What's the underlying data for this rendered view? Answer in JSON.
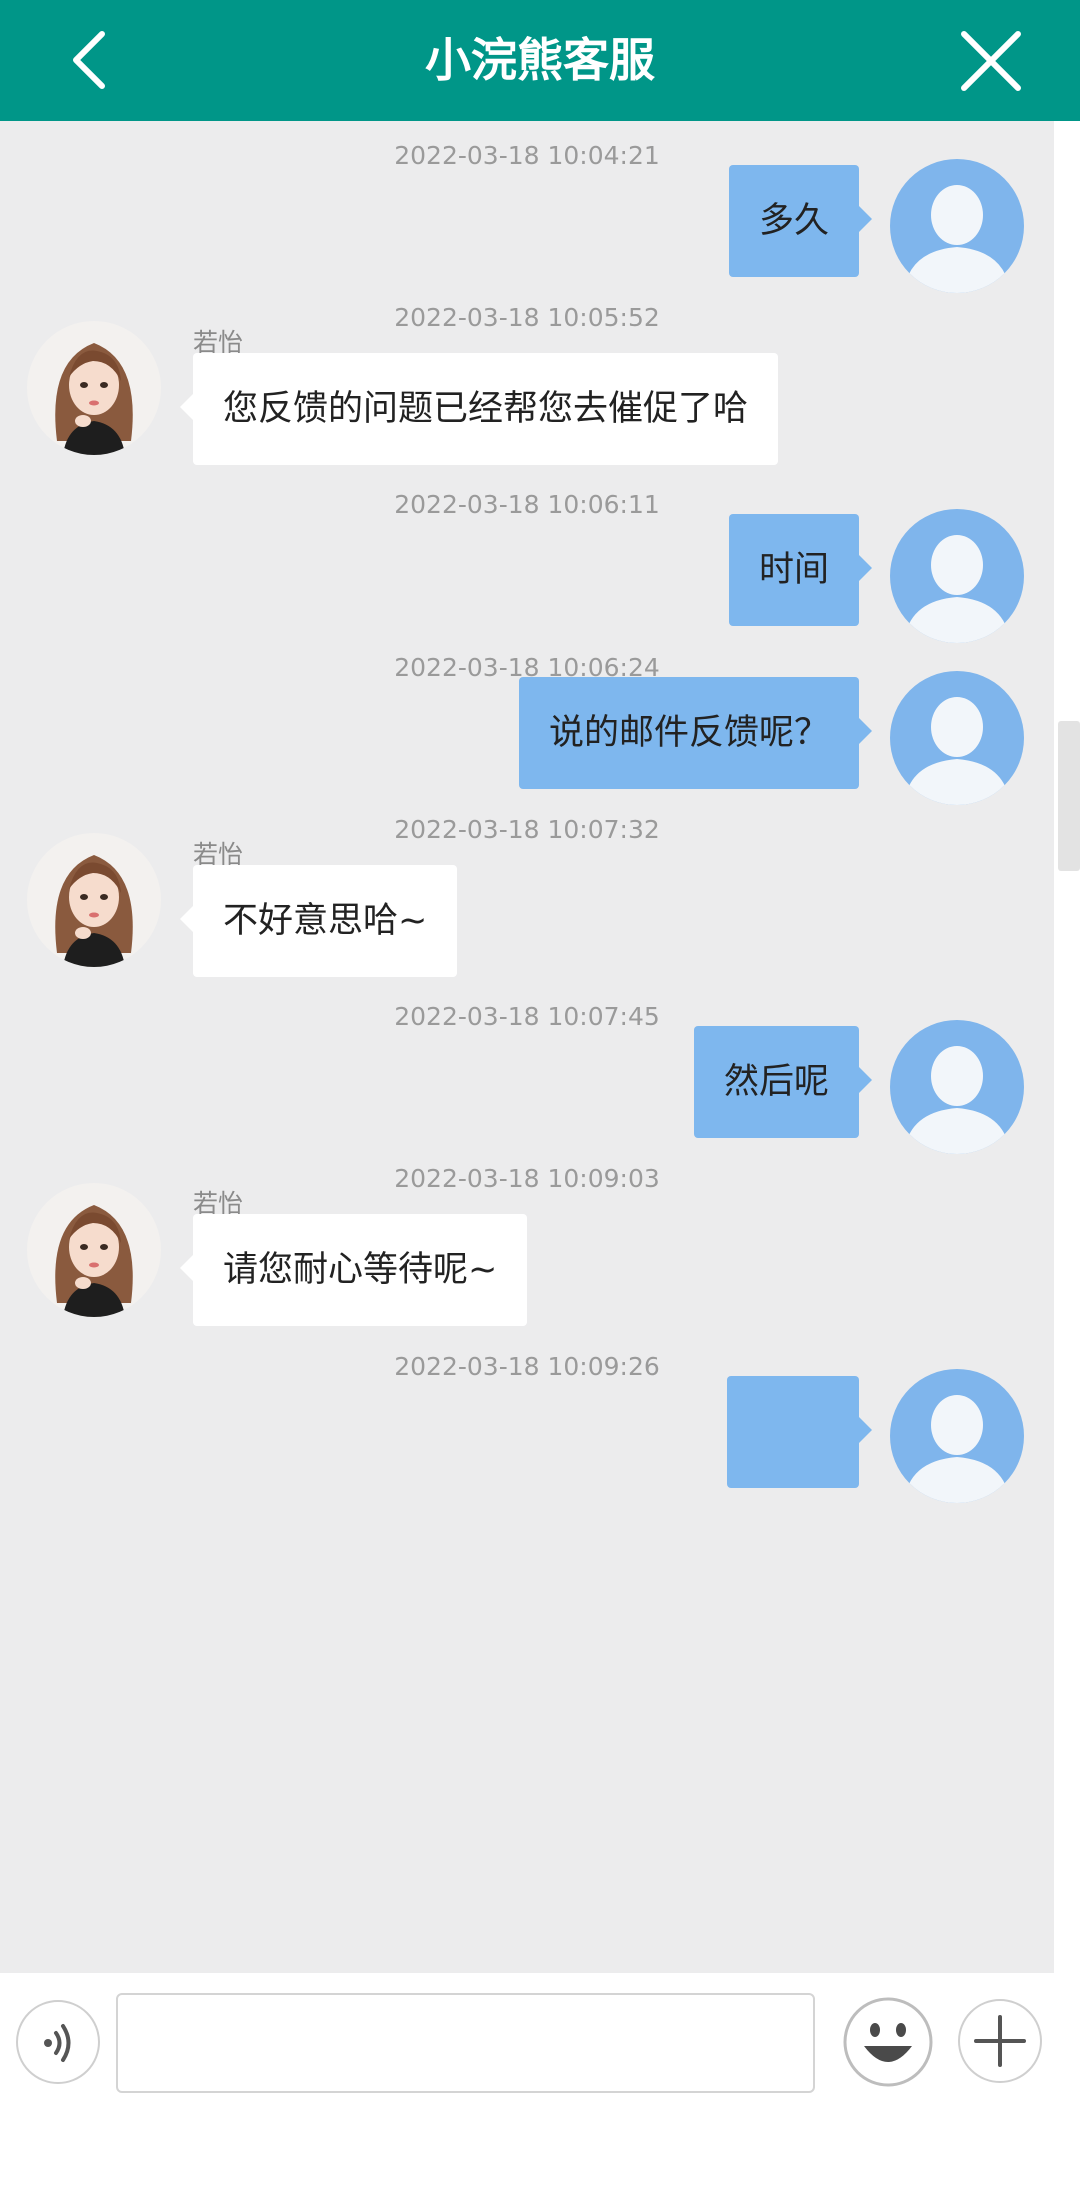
{
  "header": {
    "title": "小浣熊客服",
    "bg_color": "#009688"
  },
  "icons": {
    "back": "chevron-left-icon",
    "close": "close-icon",
    "voice": "voice-icon",
    "emoji": "emoji-icon",
    "plus": "plus-icon"
  },
  "colors": {
    "chat_bg": "#ececed",
    "outgoing_bubble": "#7eb7ee",
    "incoming_bubble": "#ffffff",
    "timestamp": "#9a9a9a"
  },
  "messages": [
    {
      "timestamp": "2022-03-18 10:04:21",
      "direction": "outgoing",
      "text": "多久"
    },
    {
      "timestamp": "2022-03-18 10:05:52",
      "direction": "incoming",
      "sender": "若怡",
      "text": "您反馈的问题已经帮您去催促了哈"
    },
    {
      "timestamp": "2022-03-18 10:06:11",
      "direction": "outgoing",
      "text": "时间"
    },
    {
      "timestamp": "2022-03-18 10:06:24",
      "direction": "outgoing",
      "text": "说的邮件反馈呢？"
    },
    {
      "timestamp": "2022-03-18 10:07:32",
      "direction": "incoming",
      "sender": "若怡",
      "text": "不好意思哈~"
    },
    {
      "timestamp": "2022-03-18 10:07:45",
      "direction": "outgoing",
      "text": "然后呢"
    },
    {
      "timestamp": "2022-03-18 10:09:03",
      "direction": "incoming",
      "sender": "若怡",
      "text": "请您耐心等待呢~"
    },
    {
      "timestamp": "2022-03-18 10:09:26",
      "direction": "outgoing",
      "text": ""
    }
  ],
  "input": {
    "value": "",
    "placeholder": ""
  }
}
